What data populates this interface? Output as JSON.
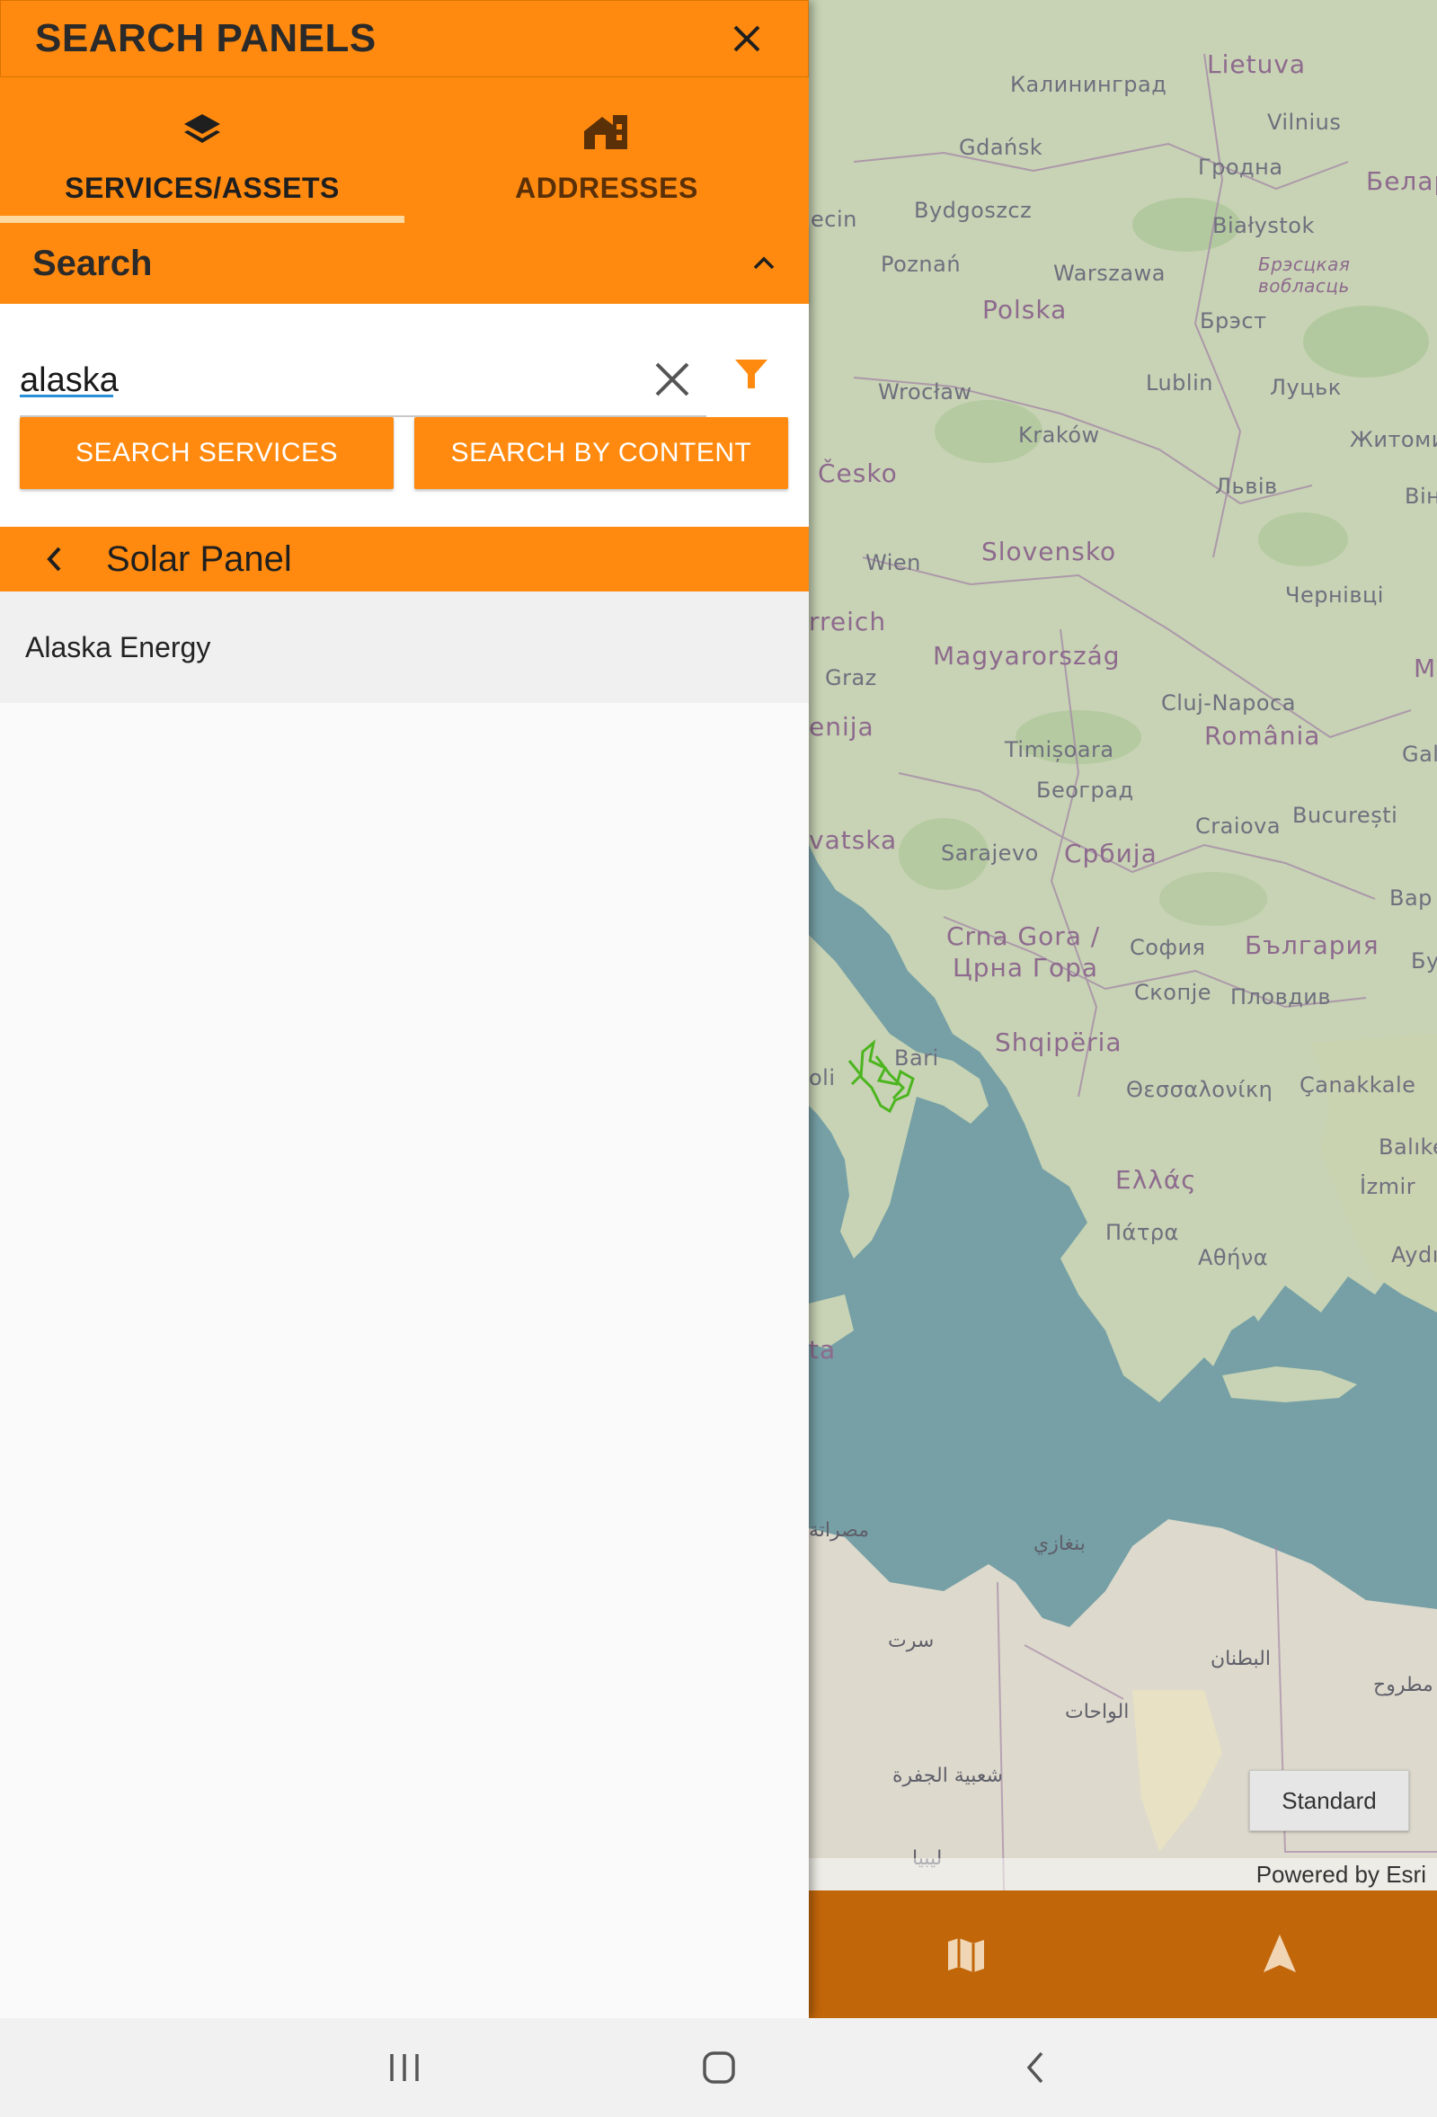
{
  "panel": {
    "title": "SEARCH PANELS",
    "tabs": [
      {
        "label": "SERVICES/ASSETS",
        "icon": "layers-icon",
        "active": true
      },
      {
        "label": "ADDRESSES",
        "icon": "house-icon",
        "active": false
      }
    ],
    "search_section": {
      "title": "Search"
    },
    "search": {
      "value": "alaska",
      "placeholder": ""
    },
    "buttons": {
      "search_services": "SEARCH SERVICES",
      "search_content": "SEARCH BY CONTENT"
    },
    "results": {
      "title": "Solar Panel",
      "items": [
        "Alaska Energy"
      ]
    }
  },
  "map": {
    "basemap_button": "Standard",
    "attribution": "Powered by Esri",
    "labels": {
      "lietuva": "Lietuva",
      "kaliningrad": "Калининград",
      "vilnius": "Vilnius",
      "gdansk": "Gdańsk",
      "grodna": "Гродна",
      "belar": "Белар",
      "bydgoszcz": "Bydgoszcz",
      "bialystok": "Białystok",
      "ecin": "ecin",
      "poznan": "Poznań",
      "warszawa": "Warszawa",
      "brest_region": "Брэсцкая вобласць",
      "polska": "Polska",
      "brest": "Брэст",
      "wroclaw": "Wrocław",
      "lublin": "Lublin",
      "lutsk": "Луцьк",
      "krakow": "Kraków",
      "zhytomyr": "Житоми",
      "cesko": "Česko",
      "lviv": "Львів",
      "vin": "Він",
      "wien": "Wien",
      "slovensko": "Slovensko",
      "chernivtsi": "Чернівці",
      "rreich": "rreich",
      "magyarorszag": "Magyarország",
      "graz": "Graz",
      "m": "M",
      "cluj": "Cluj-Napoca",
      "enija": "enija",
      "romania": "România",
      "gal": "Gal",
      "timisoara": "Timișoara",
      "beograd": "Београд",
      "craiova": "Craiova",
      "bucuresti": "București",
      "vatska": "vatska",
      "sarajevo": "Sarajevo",
      "srbija": "Србија",
      "var": "Вар",
      "crna_gora": "Crna Gora /",
      "crna_gora2": "Црна Гора",
      "sofia": "София",
      "bulgaria": "България",
      "bu": "Бу",
      "skopje": "Скопје",
      "plovdiv": "Пловдив",
      "bari": "Bari",
      "shqiperia": "Shqipëria",
      "oli": "oli",
      "thessaloniki": "Θεσσαλονίκη",
      "canakkale": "Çanakkale",
      "balike": "Balıke",
      "ellada": "Ελλάς",
      "izmir": "İzmir",
      "patra": "Πάτρα",
      "athina": "Αθήνα",
      "aydi": "Aydı",
      "ta": "ta",
      "misrata": "مصراتة",
      "benghazi": "بنغازي",
      "sirte": "سرت",
      "butnan": "البطنان",
      "matruh": "مطروح",
      "wahat": "الواحات",
      "jufra": "شعبية الجفرة",
      "libya": "ليبيا"
    }
  },
  "colors": {
    "accent": "#ff8a0f",
    "toolbar": "#c2660a",
    "sea": "#76a0a6",
    "land": "#c6d2b2"
  }
}
